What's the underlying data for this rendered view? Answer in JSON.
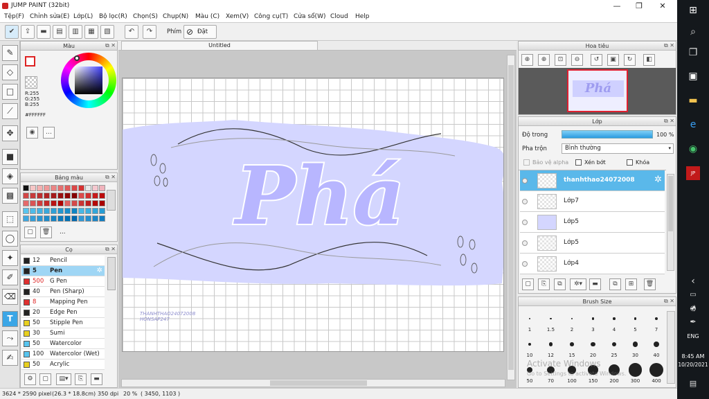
{
  "window": {
    "title": "JUMP PAINT (32bit)"
  },
  "menu": [
    "Tệp(F)",
    "Chỉnh sửa(E)",
    "Lớp(L)",
    "Bộ lọc(R)",
    "Chọn(S)",
    "Chụp(N)",
    "Màu (C)",
    "Xem(V)",
    "Công cụ(T)",
    "Cửa sổ(W)",
    "Cloud",
    "Help"
  ],
  "toolbar": {
    "phim_label": "Phím",
    "reset_label": "Đặt lại"
  },
  "color_panel": {
    "title": "Màu",
    "r": "R:255",
    "g": "G:255",
    "b": "B:255",
    "hex": "#FFFFFF"
  },
  "palette_panel": {
    "title": "Bảng màu",
    "more": "...",
    "rows": [
      [
        "#111111",
        "#f6c6c6",
        "#f3b0b0",
        "#ef9a9a",
        "#ea8585",
        "#e57070",
        "#e05b5b",
        "#db4646",
        "#d63131",
        "#e8e8e8",
        "#f5c8cf",
        "#f0b3bc"
      ],
      [
        "#d24646",
        "#c73a3a",
        "#bc2f2f",
        "#b12424",
        "#a61a1a",
        "#9b1111",
        "#900808",
        "#850000",
        "#dd4a4a",
        "#d23030",
        "#c71a1a",
        "#bc0a0a"
      ],
      [
        "#e56a6a",
        "#da5454",
        "#cf3e3e",
        "#c42929",
        "#b91414",
        "#ae0000",
        "#e06060",
        "#d54a4a",
        "#ca3434",
        "#bf1e1e",
        "#b40808",
        "#a90000"
      ],
      [
        "#58c4ee",
        "#4dbbe8",
        "#43b2e2",
        "#38a9dc",
        "#2ea0d6",
        "#2397d0",
        "#198eca",
        "#0e85c4",
        "#46b8e6",
        "#3cafe0",
        "#32a6da",
        "#289dd4"
      ],
      [
        "#3da7e0",
        "#339ed9",
        "#2995d2",
        "#1f8ccb",
        "#1583c4",
        "#0b7abd",
        "#0171b6",
        "#0068af",
        "#2f98d6",
        "#258fcf",
        "#1b86c8",
        "#117dc1"
      ]
    ]
  },
  "brush_panel": {
    "title": "Cọ",
    "items": [
      {
        "size": "12",
        "name": "Pencil",
        "color": "#222222"
      },
      {
        "size": "5",
        "name": "Pen",
        "color": "#222222",
        "selected": true
      },
      {
        "size": "500",
        "name": "G Pen",
        "color": "#e03030"
      },
      {
        "size": "40",
        "name": "Pen (Sharp)",
        "color": "#222222"
      },
      {
        "size": "8",
        "name": "Mapping Pen",
        "color": "#e03030"
      },
      {
        "size": "20",
        "name": "Edge Pen",
        "color": "#222222"
      },
      {
        "size": "50",
        "name": "Stipple Pen",
        "color": "#e8d020"
      },
      {
        "size": "30",
        "name": "Sumi",
        "color": "#e8d020"
      },
      {
        "size": "50",
        "name": "Watercolor",
        "color": "#58c4ee"
      },
      {
        "size": "100",
        "name": "Watercolor (Wet)",
        "color": "#58c4ee"
      },
      {
        "size": "50",
        "name": "Acrylic",
        "color": "#e8d020"
      }
    ]
  },
  "canvas": {
    "tab": "Untitled",
    "art_text": "Phá",
    "watermark1": "THANHTHAO24072008",
    "watermark2": "HONSAP247"
  },
  "navigator_panel": {
    "title": "Hoa tiêu"
  },
  "layer_panel": {
    "title": "Lớp",
    "opacity_label": "Độ trong",
    "opacity_value": "100 %",
    "opacity": 1.0,
    "blend_label": "Pha trộn",
    "blend_value": "Bình thường",
    "protect_alpha": "Bảo vệ alpha",
    "clip": "Xén bớt",
    "lock": "Khóa",
    "layers": [
      {
        "name": "thanhthao24072008",
        "selected": true
      },
      {
        "name": "Lớp7"
      },
      {
        "name": "Lớp5"
      },
      {
        "name": "Lớp5"
      },
      {
        "name": "Lớp4"
      }
    ]
  },
  "brush_size_panel": {
    "title": "Brush Size",
    "sizes": [
      "1",
      "1.5",
      "2",
      "3",
      "4",
      "5",
      "7",
      "10",
      "12",
      "15",
      "20",
      "25",
      "30",
      "40",
      "50",
      "70",
      "100",
      "150",
      "200",
      "300",
      "400"
    ],
    "watermark1": "Activate Windows",
    "watermark2": "Go to Settings to activate Windows."
  },
  "status": {
    "size": "3624 * 2590 pixel",
    "cm": "(26.3 * 18.8cm)",
    "dpi": "350 dpi",
    "zoom": "20 %",
    "coords": "( 3450, 1103 )"
  },
  "taskbar": {
    "lang": "ENG",
    "time": "8:45 AM",
    "date": "10/20/2021"
  },
  "colors": {
    "accent": "#5ab8ea",
    "art": "#b8b6ff",
    "backdrop": "#d4d6ff"
  }
}
